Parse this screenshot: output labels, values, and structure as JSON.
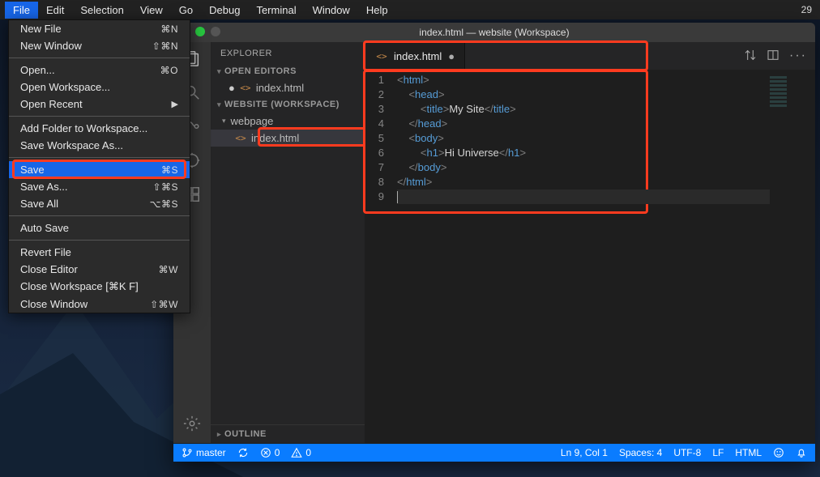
{
  "os_menu": {
    "items": [
      "File",
      "Edit",
      "Selection",
      "View",
      "Go",
      "Debug",
      "Terminal",
      "Window",
      "Help"
    ],
    "selected": "File",
    "clock": "29"
  },
  "file_menu": {
    "groups": [
      [
        {
          "label": "New File",
          "shortcut": "⌘N"
        },
        {
          "label": "New Window",
          "shortcut": "⇧⌘N"
        }
      ],
      [
        {
          "label": "Open...",
          "shortcut": "⌘O"
        },
        {
          "label": "Open Workspace...",
          "shortcut": ""
        },
        {
          "label": "Open Recent",
          "shortcut": "▶",
          "sub": true
        }
      ],
      [
        {
          "label": "Add Folder to Workspace...",
          "shortcut": ""
        },
        {
          "label": "Save Workspace As...",
          "shortcut": ""
        }
      ],
      [
        {
          "label": "Save",
          "shortcut": "⌘S",
          "highlight": true
        },
        {
          "label": "Save As...",
          "shortcut": "⇧⌘S"
        },
        {
          "label": "Save All",
          "shortcut": "⌥⌘S"
        }
      ],
      [
        {
          "label": "Auto Save",
          "shortcut": ""
        }
      ],
      [
        {
          "label": "Revert File",
          "shortcut": ""
        },
        {
          "label": "Close Editor",
          "shortcut": "⌘W"
        },
        {
          "label": "Close Workspace [⌘K F]",
          "shortcut": ""
        },
        {
          "label": "Close Window",
          "shortcut": "⇧⌘W"
        }
      ]
    ]
  },
  "window": {
    "title": "index.html — website (Workspace)"
  },
  "explorer": {
    "header": "EXPLORER",
    "open_editors_label": "OPEN EDITORS",
    "open_editors": [
      {
        "dirty": true,
        "name": "index.html"
      }
    ],
    "workspace_label": "WEBSITE (WORKSPACE)",
    "tree": [
      {
        "type": "folder",
        "name": "webpage",
        "expanded": true
      },
      {
        "type": "file",
        "name": "index.html",
        "selected": true
      }
    ],
    "outline_label": "OUTLINE"
  },
  "tab": {
    "name": "index.html"
  },
  "code": {
    "lines": [
      {
        "n": 1,
        "seg": [
          [
            "ang",
            "<"
          ],
          [
            "tag",
            "html"
          ],
          [
            "ang",
            ">"
          ]
        ]
      },
      {
        "n": 2,
        "seg": [
          [
            "txt",
            "    "
          ],
          [
            "ang",
            "<"
          ],
          [
            "tag",
            "head"
          ],
          [
            "ang",
            ">"
          ]
        ]
      },
      {
        "n": 3,
        "seg": [
          [
            "txt",
            "        "
          ],
          [
            "ang",
            "<"
          ],
          [
            "tag",
            "title"
          ],
          [
            "ang",
            ">"
          ],
          [
            "txt",
            "My Site"
          ],
          [
            "ang",
            "</"
          ],
          [
            "tag",
            "title"
          ],
          [
            "ang",
            ">"
          ]
        ]
      },
      {
        "n": 4,
        "seg": [
          [
            "txt",
            "    "
          ],
          [
            "ang",
            "</"
          ],
          [
            "tag",
            "head"
          ],
          [
            "ang",
            ">"
          ]
        ]
      },
      {
        "n": 5,
        "seg": [
          [
            "txt",
            "    "
          ],
          [
            "ang",
            "<"
          ],
          [
            "tag",
            "body"
          ],
          [
            "ang",
            ">"
          ]
        ]
      },
      {
        "n": 6,
        "seg": [
          [
            "txt",
            "        "
          ],
          [
            "ang",
            "<"
          ],
          [
            "tag",
            "h1"
          ],
          [
            "ang",
            ">"
          ],
          [
            "txt",
            "Hi Universe"
          ],
          [
            "ang",
            "</"
          ],
          [
            "tag",
            "h1"
          ],
          [
            "ang",
            ">"
          ]
        ]
      },
      {
        "n": 7,
        "seg": [
          [
            "txt",
            "    "
          ],
          [
            "ang",
            "</"
          ],
          [
            "tag",
            "body"
          ],
          [
            "ang",
            ">"
          ]
        ]
      },
      {
        "n": 8,
        "seg": [
          [
            "ang",
            "</"
          ],
          [
            "tag",
            "html"
          ],
          [
            "ang",
            ">"
          ]
        ]
      },
      {
        "n": 9,
        "seg": []
      }
    ]
  },
  "status": {
    "branch": "master",
    "errors": "0",
    "warnings": "0",
    "cursor": "Ln 9, Col 1",
    "spaces": "Spaces: 4",
    "encoding": "UTF-8",
    "eol": "LF",
    "lang": "HTML"
  }
}
